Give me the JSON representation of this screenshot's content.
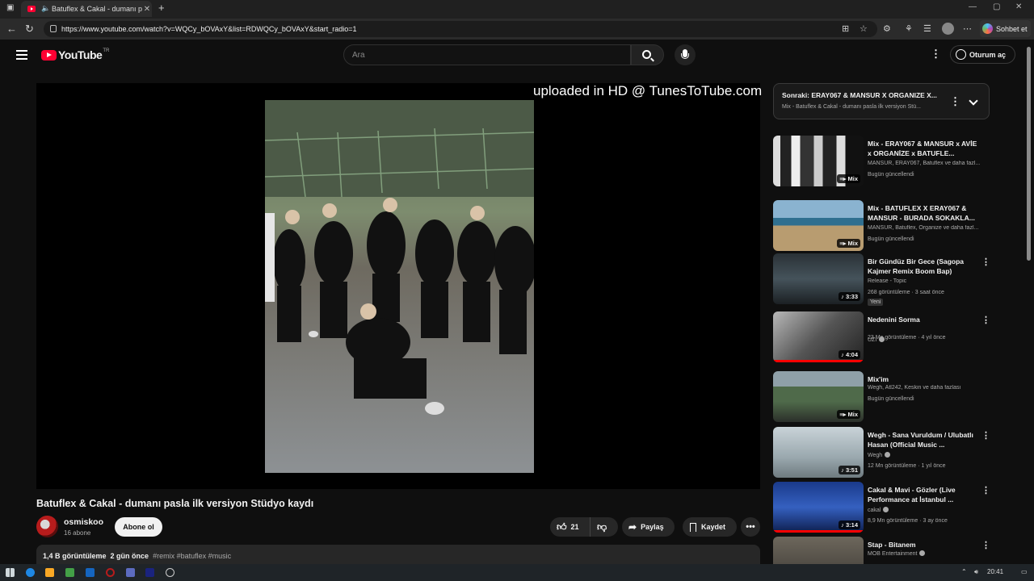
{
  "browser": {
    "tab_title": "Batuflex & Cakal - dumanı pasla ilk versiyon Stüdyo kaydı",
    "url": "https://www.youtube.com/watch?v=WQCy_bOVAxY&list=RDWQCy_bOVAxY&start_radio=1",
    "copilot_label": "Sohbet et"
  },
  "header": {
    "logo_text": "YouTube",
    "region": "TR",
    "search_placeholder": "Ara",
    "signin_label": "Oturum aç"
  },
  "video": {
    "watermark": "uploaded in HD @ TunesToTube.com",
    "title": "Batuflex & Cakal - dumanı pasla ilk versiyon Stüdyo kaydı",
    "channel": "osmiskoo",
    "subscribers": "16 abone",
    "subscribe_label": "Abone ol",
    "likes": "21",
    "share_label": "Paylaş",
    "save_label": "Kaydet",
    "views": "1,4 B görüntüleme",
    "age": "2 gün önce",
    "tags": "#remix #batuflex #music"
  },
  "up_next": {
    "title": "Sonraki: ERAY067 & MANSUR X ORGANIZE X...",
    "subtitle": "Mix - Batuflex & Cakal - dumanı pasla ilk versiyon Stü..."
  },
  "sidebar": {
    "items": [
      {
        "title": "Mix - ERAY067 & MANSUR x AVİE x ORGANİZE x BATUFLE...",
        "channel": "MANSUR, ERAY067, Batuflex ve daha fazl...",
        "meta": "Bugün güncellendi",
        "badge": "Mix"
      },
      {
        "title": "Mix - BATUFLEX X ERAY067 & MANSUR - BURADA SOKAKLA...",
        "channel": "MANSUR, Batuflex, Organize ve daha fazl...",
        "meta": "Bugün güncellendi",
        "badge": "Mix"
      },
      {
        "title": "Bir Gündüz Bir Gece (Sagopa Kajmer Remix Boom Bap)",
        "channel": "Release - Topic",
        "meta": "268 görüntüleme · 3 saat önce",
        "badge": "3:33",
        "tag": "Yeni"
      },
      {
        "title": "Nedenini Sorma",
        "channel": "UZI",
        "meta": "23 Mn görüntüleme · 4 yıl önce",
        "badge": "4:04"
      },
      {
        "title": "Mix'im",
        "channel": "Wegh, Atl242, Keskin ve daha fazlası",
        "meta": "Bugün güncellendi",
        "badge": "Mix"
      },
      {
        "title": "Wegh - Sana Vuruldum / Ulubatlı Hasan (Official Music ...",
        "channel": "Wegh",
        "meta": "12 Mn görüntüleme · 1 yıl önce",
        "badge": "3:51"
      },
      {
        "title": "Cakal & Mavi - Gözler (Live Performance at İstanbul ...",
        "channel": "cakal",
        "meta": "8,9 Mn görüntüleme · 3 ay önce",
        "badge": "3:14"
      },
      {
        "title": "Stap - Bitanem",
        "channel": "MOB Entertainment",
        "meta": "",
        "badge": ""
      }
    ]
  },
  "taskbar": {
    "time": "20:41"
  },
  "colors": {
    "accent": "#ff0033",
    "bg": "#0f0f0f"
  }
}
